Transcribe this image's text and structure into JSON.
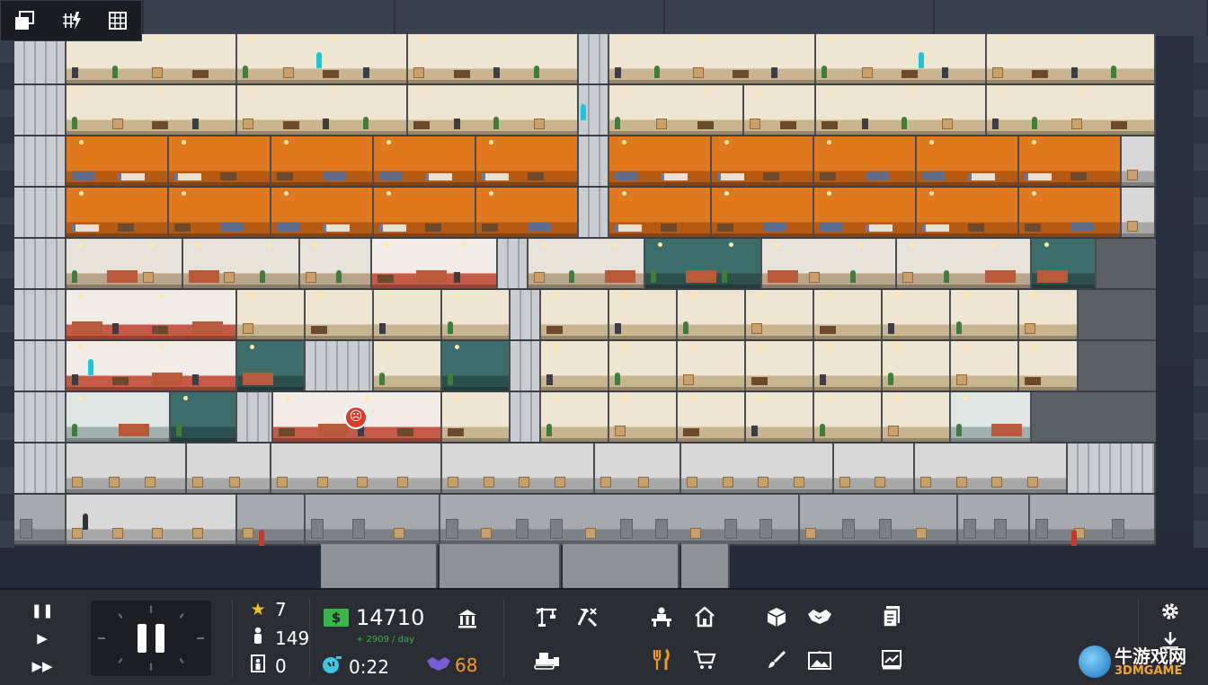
{
  "view_toolbar": {
    "icons": [
      "windows-icon",
      "grid-power-icon",
      "building-grid-icon"
    ]
  },
  "speed_controls": {
    "icons": [
      "pause-icon",
      "play-icon",
      "fast-forward-icon"
    ]
  },
  "stats": {
    "rating": "7",
    "population": "149",
    "tenants_needing": "0",
    "money": "14710",
    "money_rate": "+ 2909 / day",
    "time": "0:22",
    "partners": "68"
  },
  "colors": {
    "hud_background": "#2b2d34",
    "money_green": "#39b54a",
    "accent_orange": "#f39a1e",
    "partners_purple": "#7a5cd6",
    "office_orange": "#e0781e",
    "angry_red": "#e23a2a"
  },
  "tools": {
    "bank": "bank-icon",
    "construction": "crane-icon",
    "demolish": "hammer-icon",
    "bulldozer": "bulldozer-icon",
    "office": "office-desk-icon",
    "housing": "house-icon",
    "food": "fork-knife-icon",
    "shop": "shopping-cart-icon",
    "storage": "box-icon",
    "contracts": "handshake-icon",
    "decor": "paint-brush-icon",
    "gallery": "picture-icon",
    "documents": "document-dollar-icon",
    "reports": "chart-report-icon",
    "settings": "gear-icon",
    "save": "download-icon"
  },
  "watermark": {
    "cn": "牛游戏网",
    "en": "3DMGAME"
  }
}
